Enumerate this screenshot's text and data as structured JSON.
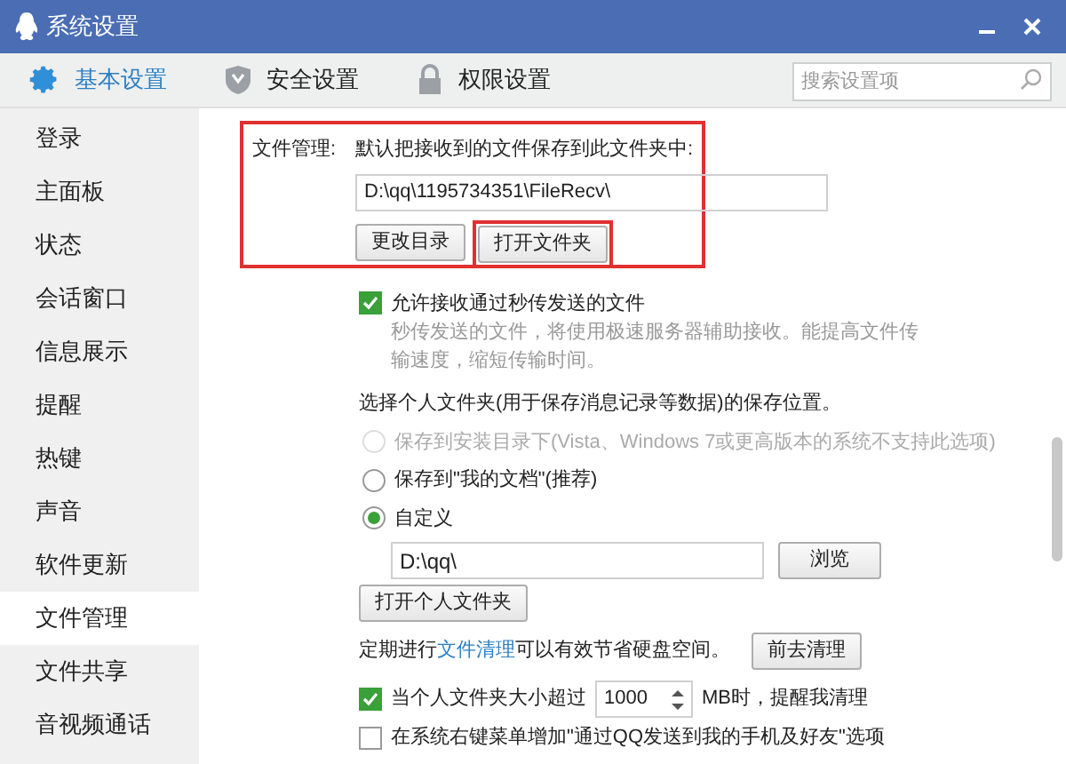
{
  "window": {
    "title": "系统设置"
  },
  "tabs": [
    {
      "label": "基本设置",
      "selected": true
    },
    {
      "label": "安全设置",
      "selected": false
    },
    {
      "label": "权限设置",
      "selected": false
    }
  ],
  "search": {
    "placeholder": "搜索设置项"
  },
  "sidebar": {
    "items": [
      {
        "label": "登录",
        "selected": false
      },
      {
        "label": "主面板",
        "selected": false
      },
      {
        "label": "状态",
        "selected": false
      },
      {
        "label": "会话窗口",
        "selected": false
      },
      {
        "label": "信息展示",
        "selected": false
      },
      {
        "label": "提醒",
        "selected": false
      },
      {
        "label": "热键",
        "selected": false
      },
      {
        "label": "声音",
        "selected": false
      },
      {
        "label": "软件更新",
        "selected": false
      },
      {
        "label": "文件管理",
        "selected": true
      },
      {
        "label": "文件共享",
        "selected": false
      },
      {
        "label": "音视频通话",
        "selected": false
      }
    ]
  },
  "file_management": {
    "label": "文件管理:",
    "description": "默认把接收到的文件保存到此文件夹中:",
    "path": "D:\\qq\\1195734351\\FileRecv\\",
    "buttons": [
      "更改目录",
      "打开文件夹"
    ]
  },
  "instant_transfer": {
    "label": "允许接收通过秒传发送的文件",
    "checked": true,
    "note": "秒传发送的文件，将使用极速服务器辅助接收。能提高文件传输速度，缩短传输时间。"
  },
  "personal_folder": {
    "heading": "选择个人文件夹(用于保存消息记录等数据)的保存位置。",
    "options": [
      {
        "label": "保存到安装目录下(Vista、Windows 7或更高版本的系统不支持此选项)",
        "selected": false,
        "disabled": true
      },
      {
        "label": "保存到\"我的文档\"(推荐)",
        "selected": false,
        "disabled": false
      },
      {
        "label": "自定义",
        "selected": true,
        "disabled": false
      }
    ],
    "path": "D:\\qq\\",
    "browse": "浏览",
    "open": "打开个人文件夹"
  },
  "cleanup": {
    "before": "定期进行",
    "link": "文件清理",
    "after": "可以有效节省硬盘空间。",
    "button": "前去清理"
  },
  "size_warning": {
    "checked": true,
    "before": "当个人文件夹大小超过",
    "value": "1000",
    "after": "MB时，提醒我清理"
  },
  "context_menu": {
    "checked": false,
    "label": "在系统右键菜单增加\"通过QQ发送到我的手机及好友\"选项"
  }
}
